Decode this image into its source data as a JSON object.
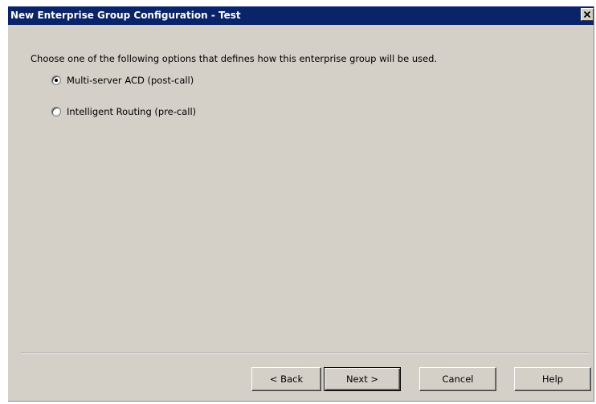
{
  "window": {
    "title": "New Enterprise Group Configuration - Test",
    "close_glyph": "✕"
  },
  "content": {
    "prompt": "Choose one of the following options that defines how this enterprise group will be used.",
    "options": [
      {
        "label": "Multi-server ACD (post-call)",
        "selected": true
      },
      {
        "label": "Intelligent Routing (pre-call)",
        "selected": false
      }
    ]
  },
  "buttons": {
    "back": "< Back",
    "next": "Next >",
    "cancel": "Cancel",
    "help": "Help"
  },
  "colors": {
    "titlebar": "#0a246a",
    "dialog_bg": "#d4d0c8"
  }
}
